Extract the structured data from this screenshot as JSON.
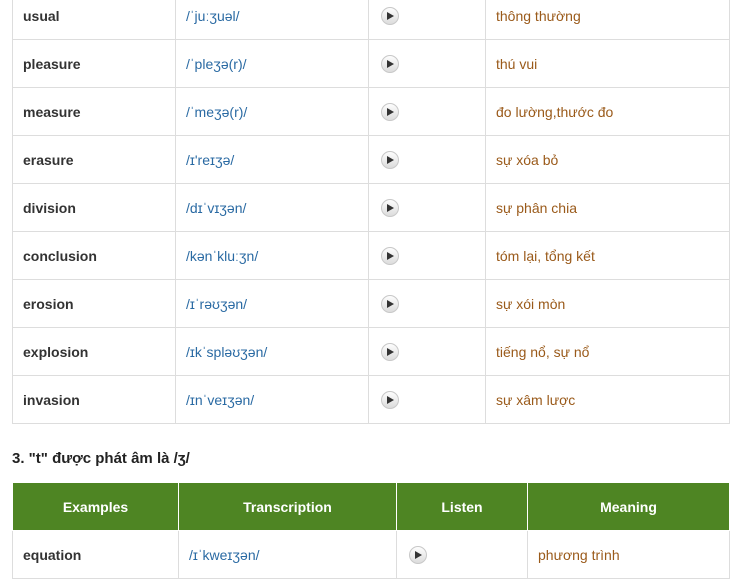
{
  "vocab_rows": [
    {
      "word": "usual",
      "ipa": "/ˈjuːʒuəl/",
      "meaning": "thông thường"
    },
    {
      "word": "pleasure",
      "ipa": "/ˈpleʒə(r)/",
      "meaning": "thú vui"
    },
    {
      "word": "measure",
      "ipa": "/ˈmeʒə(r)/",
      "meaning": "đo lường,thước đo"
    },
    {
      "word": "erasure",
      "ipa": "/ɪ'reɪʒə/",
      "meaning": "sự xóa bỏ"
    },
    {
      "word": "division",
      "ipa": "/dɪˈvɪʒən/",
      "meaning": "sự phân chia"
    },
    {
      "word": "conclusion",
      "ipa": "/kənˈkluːʒn/",
      "meaning": "tóm lại, tổng kết"
    },
    {
      "word": "erosion",
      "ipa": "/ɪˈrəʊʒən/",
      "meaning": "sự xói mòn"
    },
    {
      "word": "explosion",
      "ipa": "/ɪkˈspləʊʒən/",
      "meaning": "tiếng nổ, sự nổ"
    },
    {
      "word": "invasion",
      "ipa": "/ɪnˈveɪʒən/",
      "meaning": "sự xâm lược"
    }
  ],
  "section": {
    "heading": "3. \"t\" được phát âm là /ʒ/"
  },
  "examples_table": {
    "headers": [
      "Examples",
      "Transcription",
      "Listen",
      "Meaning"
    ],
    "rows": [
      {
        "word": "equation",
        "ipa": "/ɪˈkweɪʒən/",
        "meaning": "phương trình"
      }
    ]
  },
  "colors": {
    "header_green": "#4e8523",
    "ipa_blue": "#2a6aa3",
    "meaning_brown": "#9a5a1a"
  },
  "icons": {
    "listen": "play-audio-icon"
  }
}
